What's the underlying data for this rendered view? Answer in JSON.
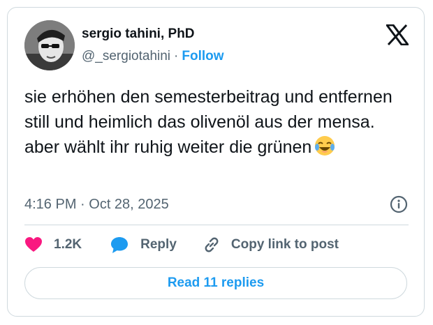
{
  "author": {
    "name": "sergio tahini, PhD",
    "handle": "@_sergiotahini",
    "separator": "·",
    "follow_label": "Follow"
  },
  "tweet": {
    "text": "sie erhöhen den semesterbeitrag und entfernen still und heimlich das olivenöl aus der mensa. aber wählt ihr ruhig weiter die grünen",
    "emoji": "face-with-tears-of-joy",
    "timestamp": "4:16 PM · Oct 28, 2025"
  },
  "actions": {
    "like_count": "1.2K",
    "reply_label": "Reply",
    "copy_label": "Copy link to post"
  },
  "read_replies_label": "Read 11 replies",
  "colors": {
    "accent": "#1d9bf0",
    "like": "#f91880",
    "text": "#0f1419",
    "muted": "#536471",
    "border": "#cfd9de"
  }
}
